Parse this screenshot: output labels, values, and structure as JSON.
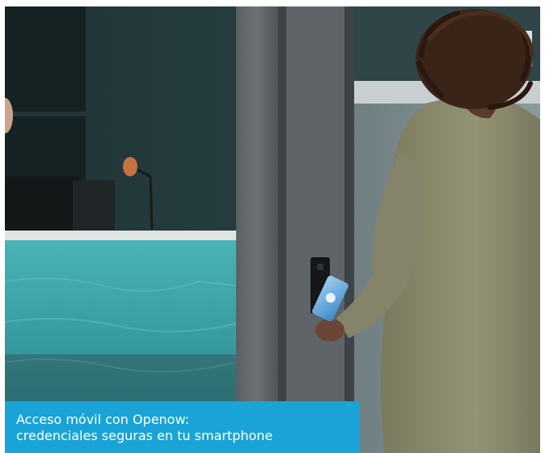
{
  "caption": {
    "line1": "Acceso móvil con Openow:",
    "line2": "credenciales seguras en tu smartphone"
  },
  "colors": {
    "caption_background": "#1aa3d6",
    "caption_text": "#ffffff",
    "wall": "#2b4548",
    "reception_desk": "#3aa0a4",
    "jacket": "#8c8a6c"
  }
}
